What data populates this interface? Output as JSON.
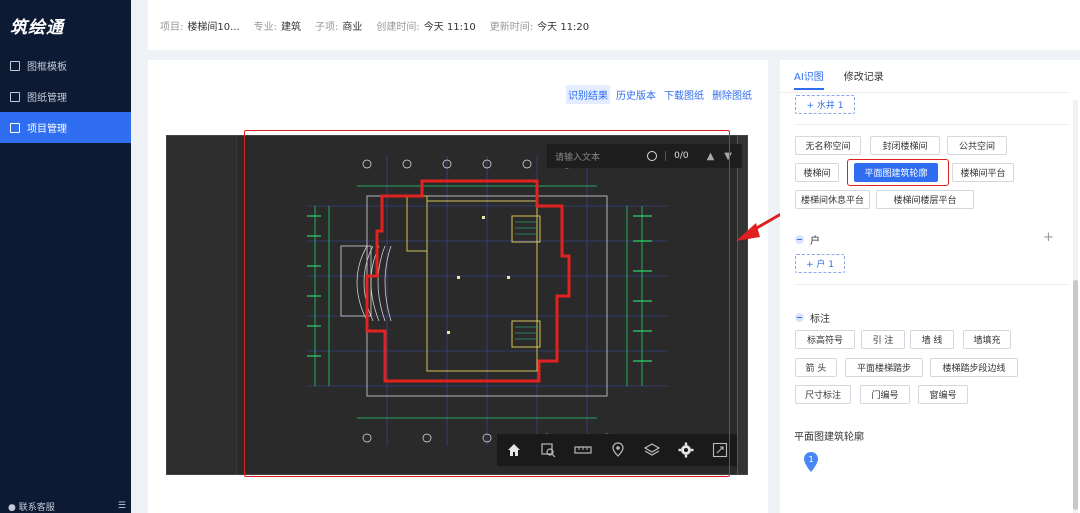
{
  "app": {
    "logo": "筑绘通"
  },
  "sidebar": {
    "items": [
      {
        "label": "图框模板",
        "active": false
      },
      {
        "label": "图纸管理",
        "active": false
      },
      {
        "label": "项目管理",
        "active": true
      }
    ],
    "footer": "联系客服"
  },
  "header": {
    "project_label": "项目:",
    "project_value": "楼梯间10...",
    "major_label": "专业:",
    "major_value": "建筑",
    "sub_label": "子项:",
    "sub_value": "商业",
    "created_label": "创建时间:",
    "created_value": "今天 11:10",
    "updated_label": "更新时间:",
    "updated_value": "今天 11:20"
  },
  "actions": [
    "识别结果",
    "历史版本",
    "下载图纸",
    "删除图纸"
  ],
  "viewer": {
    "search_placeholder": "请输入文本",
    "search_count": "0/0"
  },
  "right_panel": {
    "tabs": [
      "AI识图",
      "修改记录"
    ],
    "water_tag": "+ 水井 1",
    "space_tags": [
      "无名称空间",
      "封闭楼梯间",
      "公共空间",
      "楼梯间",
      "平面图建筑轮廓",
      "楼梯间平台",
      "楼梯间休息平台",
      "楼梯间楼层平台"
    ],
    "household_title": "户",
    "household_tag": "+ 户 1",
    "annotation_title": "标注",
    "annotation_tags": [
      "标高符号",
      "引 注",
      "墙 线",
      "墙填充",
      "箭 头",
      "平面楼梯踏步",
      "楼梯踏步段边线",
      "尺寸标注",
      "门编号",
      "窗编号"
    ],
    "contour_title": "平面图建筑轮廓",
    "pin_number": "1"
  },
  "colors": {
    "accent": "#2f6ef1",
    "sidebar": "#0c1a33",
    "highlight": "#e02020"
  }
}
